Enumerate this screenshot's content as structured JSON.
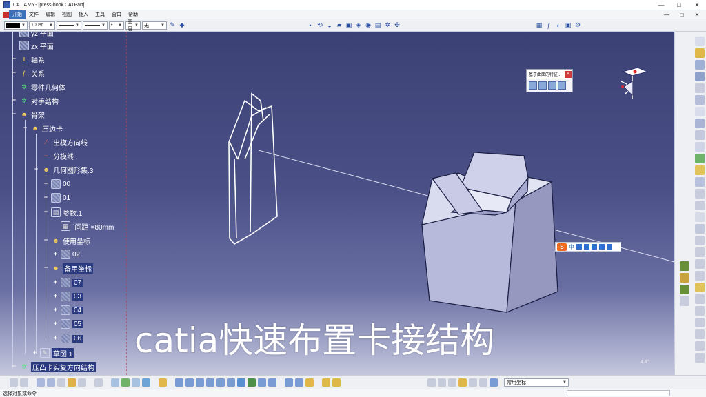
{
  "window": {
    "title": "CATIA V5 - [press-hook.CATPart]",
    "controls": [
      "—",
      "□",
      "✕"
    ],
    "mdi_controls": [
      "—",
      "□",
      "✕"
    ]
  },
  "menu": {
    "items": [
      "开始",
      "文件",
      "编辑",
      "视图",
      "插入",
      "工具",
      "窗口",
      "帮助"
    ],
    "active": "开始"
  },
  "toolbar": {
    "color_value": "",
    "transparency": "100%",
    "line_type": "",
    "line_weight": "",
    "point_type": "•",
    "layer_label": "图层",
    "layer_value": "无"
  },
  "tree": {
    "nodes": [
      {
        "label": "yz 平面",
        "icon": "plane-icon"
      },
      {
        "label": "zx 平面",
        "icon": "plane-icon"
      },
      {
        "label": "轴系",
        "icon": "axis-system-icon"
      },
      {
        "label": "关系",
        "icon": "relations-icon"
      },
      {
        "label": "零件几何体",
        "icon": "body-icon"
      },
      {
        "label": "对手结构",
        "icon": "body-icon"
      },
      {
        "label": "骨架",
        "icon": "skeleton-icon"
      },
      {
        "label": "压边卡",
        "icon": "skeleton-icon"
      },
      {
        "label": "出模方向线",
        "icon": "curve-icon"
      },
      {
        "label": "分模线",
        "icon": "curve-icon"
      },
      {
        "label": "几何图形集.3",
        "icon": "geometric-set-icon"
      },
      {
        "label": "00",
        "icon": "point-icon"
      },
      {
        "label": "01",
        "icon": "point-icon"
      },
      {
        "label": "参数.1",
        "icon": "parameter-set-icon"
      },
      {
        "label": "`间距`=80mm",
        "icon": "parameter-icon"
      },
      {
        "label": "使用坐标",
        "icon": "geometric-set-icon"
      },
      {
        "label": "02",
        "icon": "point-icon"
      },
      {
        "label": "备用坐标",
        "icon": "geometric-set-icon"
      },
      {
        "label": "07",
        "icon": "point-icon"
      },
      {
        "label": "03",
        "icon": "point-icon"
      },
      {
        "label": "04",
        "icon": "point-icon"
      },
      {
        "label": "05",
        "icon": "point-icon"
      },
      {
        "label": "06",
        "icon": "point-icon"
      },
      {
        "label": "草图.1",
        "icon": "sketch-icon"
      },
      {
        "label": "压凸卡实复方向结构",
        "icon": "body-icon"
      }
    ]
  },
  "overlay": {
    "caption": "catia快速布置卡接结构"
  },
  "popup": {
    "title": "基于曲面的特征..."
  },
  "ime": {
    "label": "中"
  },
  "viewport": {
    "scale_text": "4.4°"
  },
  "bottom": {
    "combo_value": "常用坐标"
  },
  "status": {
    "text": "选择对象或命令"
  }
}
